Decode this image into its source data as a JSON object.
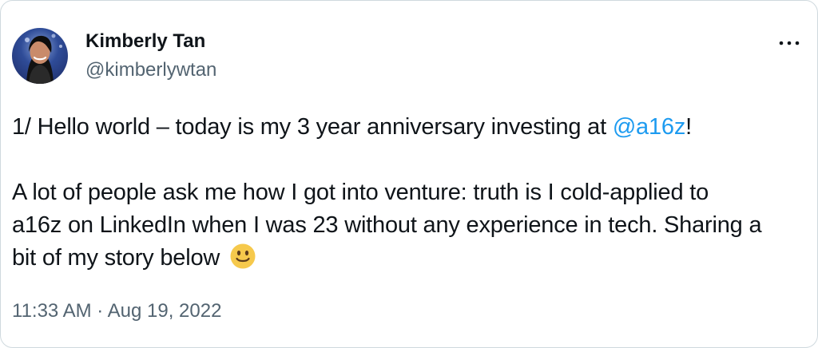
{
  "author": {
    "name": "Kimberly Tan",
    "handle": "@kimberlywtan",
    "avatar_icon": "profile-avatar"
  },
  "menu": {
    "icon": "more-horizontal-icon"
  },
  "tweet": {
    "line1_prefix": "1/ Hello world – today is my 3 year anniversary investing at ",
    "mention": "@a16z",
    "line1_suffix": "!",
    "line2": "A lot of people ask me how I got into venture: truth is I cold-applied to",
    "line3": "a16z on LinkedIn when I was 23 without any experience in tech. Sharing a",
    "line4": "bit of my story below",
    "emoji": "slightly-smiling-face-icon"
  },
  "meta": {
    "time": "11:33 AM",
    "separator": " · ",
    "date": "Aug 19, 2022"
  },
  "colors": {
    "accent": "#1d9bf0",
    "secondary_text": "#536471",
    "primary_text": "#0f1419"
  }
}
